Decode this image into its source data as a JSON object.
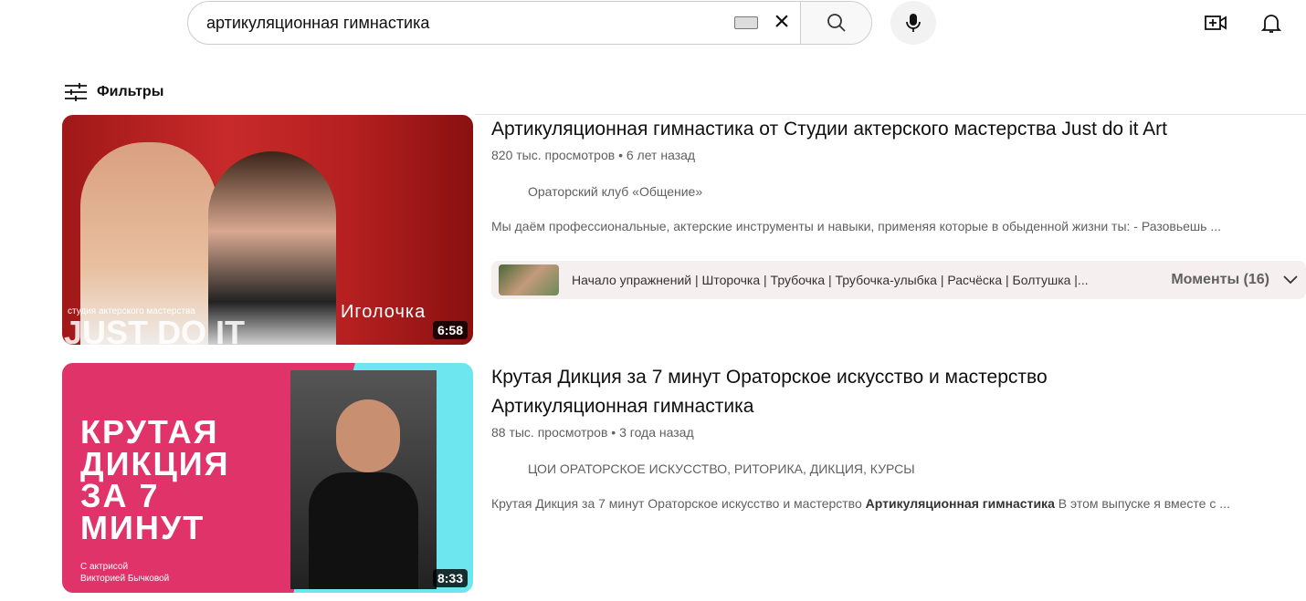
{
  "search": {
    "query": "артикуляционная гимнастика"
  },
  "filters": {
    "label": "Фильтры"
  },
  "results": [
    {
      "title": "Артикуляционная гимнастика от Студии актерского мастерства Just do it Art",
      "views": "820 тыс. просмотров",
      "age": "6 лет назад",
      "channel": "Ораторский клуб «Общение»",
      "description": "Мы даём профессиональные, актерские инструменты и навыки, применяя которые в обыденной жизни ты: - Разовьешь ...",
      "duration": "6:58",
      "thumb_text": {
        "caption": "Иголочка",
        "logo": "JUST DO IT",
        "logo_sub": "студия актерского мастерства"
      },
      "moments": {
        "chapters": "Начало упражнений | Шторочка | Трубочка | Трубочка-улыбка | Расчёска | Болтушка |...",
        "label": "Моменты (16)"
      }
    },
    {
      "title": "Крутая Дикция за 7 минут Ораторское искусство и мастерство Артикуляционная гимнастика",
      "views": "88 тыс. просмотров",
      "age": "3 года назад",
      "channel": "ЦОИ ОРАТОРСКОЕ ИСКУССТВО, РИТОРИКА, ДИКЦИЯ, КУРСЫ",
      "description_pre": "Крутая Дикция за 7 минут Ораторское искусство и мастерство ",
      "description_bold": "Артикуляционная гимнастика",
      "description_post": " В этом выпуске я вместе с ...",
      "duration": "8:33",
      "thumb_text": {
        "headline": "КРУТАЯ ДИКЦИЯ ЗА 7 МИНУТ",
        "sub1": "С актрисой",
        "sub2": "Викторией Бычковой"
      }
    }
  ]
}
